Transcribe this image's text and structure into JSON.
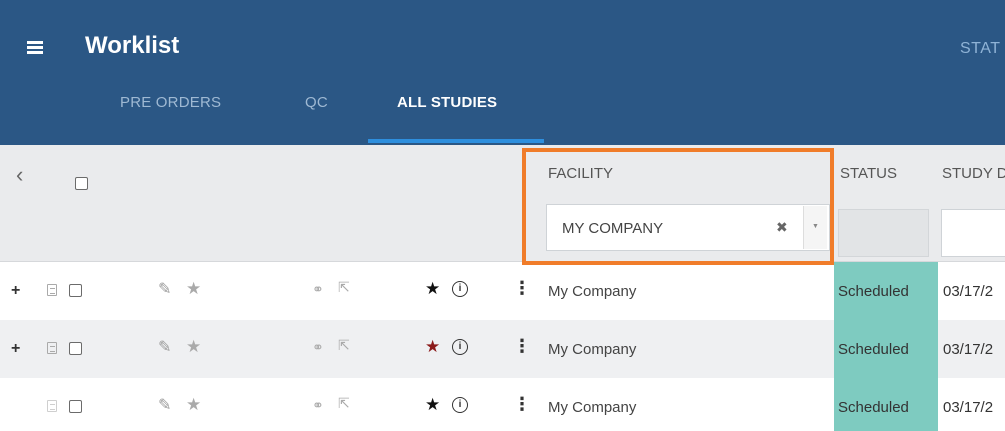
{
  "app": {
    "title": "Worklist",
    "stat_label": "STAT",
    "menu_icon": "hamburger-menu-icon"
  },
  "tabs": [
    {
      "label": "PRE ORDERS",
      "active": false
    },
    {
      "label": "QC",
      "active": false
    },
    {
      "label": "ALL STUDIES",
      "active": true
    }
  ],
  "columns": {
    "facility": "FACILITY",
    "status": "STATUS",
    "study_date": "STUDY D"
  },
  "filters": {
    "facility_value": "MY COMPANY",
    "clear_glyph": "✖",
    "dropdown_glyph": "▼"
  },
  "rows": [
    {
      "expand": "+",
      "facility": "My Company",
      "status": "Scheduled",
      "date": "03/17/2",
      "priority_star_color": "#111111"
    },
    {
      "expand": "+",
      "facility": "My Company",
      "status": "Scheduled",
      "date": "03/17/2",
      "priority_star_color": "#8b1a1a"
    },
    {
      "expand": "",
      "facility": "My Company",
      "status": "Scheduled",
      "date": "03/17/2",
      "priority_star_color": "#111111"
    }
  ],
  "colors": {
    "header_bg": "#2b5785",
    "tab_underline": "#2e8fde",
    "highlight_border": "#f07c2a",
    "status_scheduled_bg": "#7ecbc0"
  }
}
